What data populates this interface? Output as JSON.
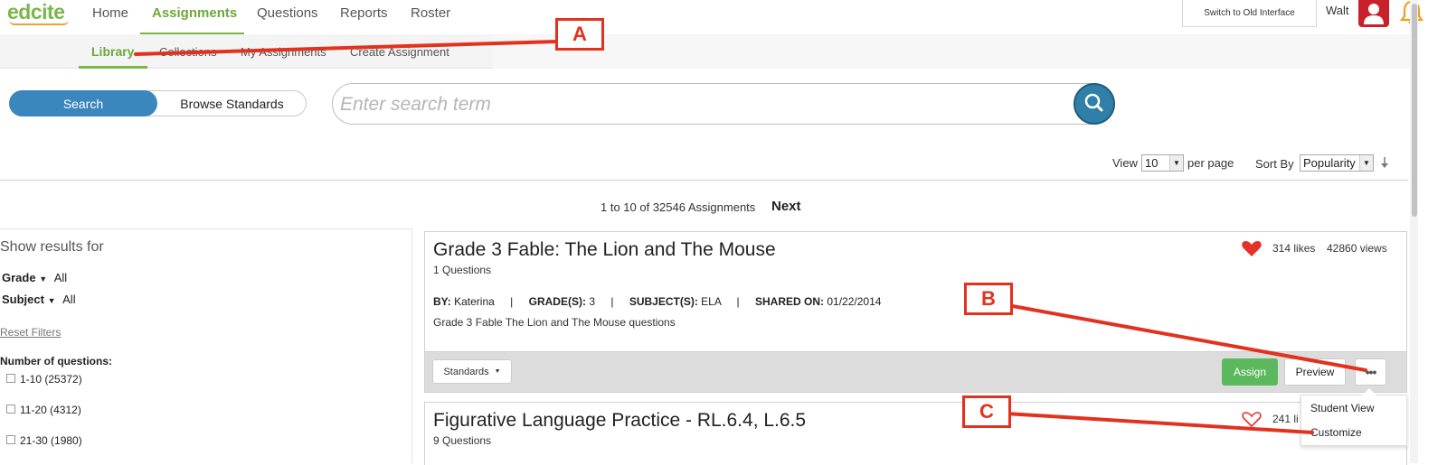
{
  "brand": {
    "logo_text": "edcite",
    "accent": "#7ab648",
    "primary": "#3a86bd"
  },
  "topnav": {
    "items": [
      {
        "label": "Home"
      },
      {
        "label": "Assignments"
      },
      {
        "label": "Questions"
      },
      {
        "label": "Reports"
      },
      {
        "label": "Roster"
      }
    ],
    "active": "Assignments",
    "old_interface_label": "Switch to Old Interface",
    "username": "Walt"
  },
  "subnav": {
    "items": [
      {
        "label": "Library"
      },
      {
        "label": "Collections"
      },
      {
        "label": "My Assignments"
      },
      {
        "label": "Create Assignment"
      }
    ],
    "active": "Library"
  },
  "search": {
    "toggle_active": "Search",
    "toggle_other": "Browse Standards",
    "placeholder": "Enter search term"
  },
  "paging": {
    "view_label": "View",
    "view_value": "10",
    "per_page_label": "per page",
    "sort_label": "Sort By",
    "sort_value": "Popularity",
    "range_text": "1 to 10 of 32546 Assignments",
    "next_label": "Next"
  },
  "sidebar": {
    "title": "Show results for",
    "grade_label": "Grade",
    "grade_value": "All",
    "subject_label": "Subject",
    "subject_value": "All",
    "reset_label": "Reset Filters",
    "num_questions_label": "Number of questions:",
    "num_questions_options": [
      {
        "label": "1-10 (25372)"
      },
      {
        "label": "11-20 (4312)"
      },
      {
        "label": "21-30 (1980)"
      }
    ]
  },
  "results": [
    {
      "title": "Grade 3 Fable: The Lion and The Mouse",
      "question_count": "1 Questions",
      "by_label": "BY:",
      "by_value": "Katerina",
      "grade_label": "GRADE(S):",
      "grade_value": "3",
      "subject_label": "SUBJECT(S):",
      "subject_value": "ELA",
      "shared_label": "SHARED ON:",
      "shared_value": "01/22/2014",
      "description": "Grade 3 Fable The Lion and The Mouse questions",
      "likes": "314 likes",
      "views": "42860 views",
      "liked": true,
      "standards_label": "Standards",
      "assign_label": "Assign",
      "preview_label": "Preview",
      "more_label": "•••"
    },
    {
      "title": "Figurative Language Practice - RL.6.4, L.6.5",
      "question_count": "9 Questions",
      "likes": "241 li",
      "liked": false
    }
  ],
  "more_menu": {
    "items": [
      {
        "label": "Student View"
      },
      {
        "label": "Customize"
      }
    ]
  },
  "annotations": {
    "color": "#e2321e",
    "callouts": [
      {
        "label": "A"
      },
      {
        "label": "B"
      },
      {
        "label": "C"
      }
    ]
  }
}
